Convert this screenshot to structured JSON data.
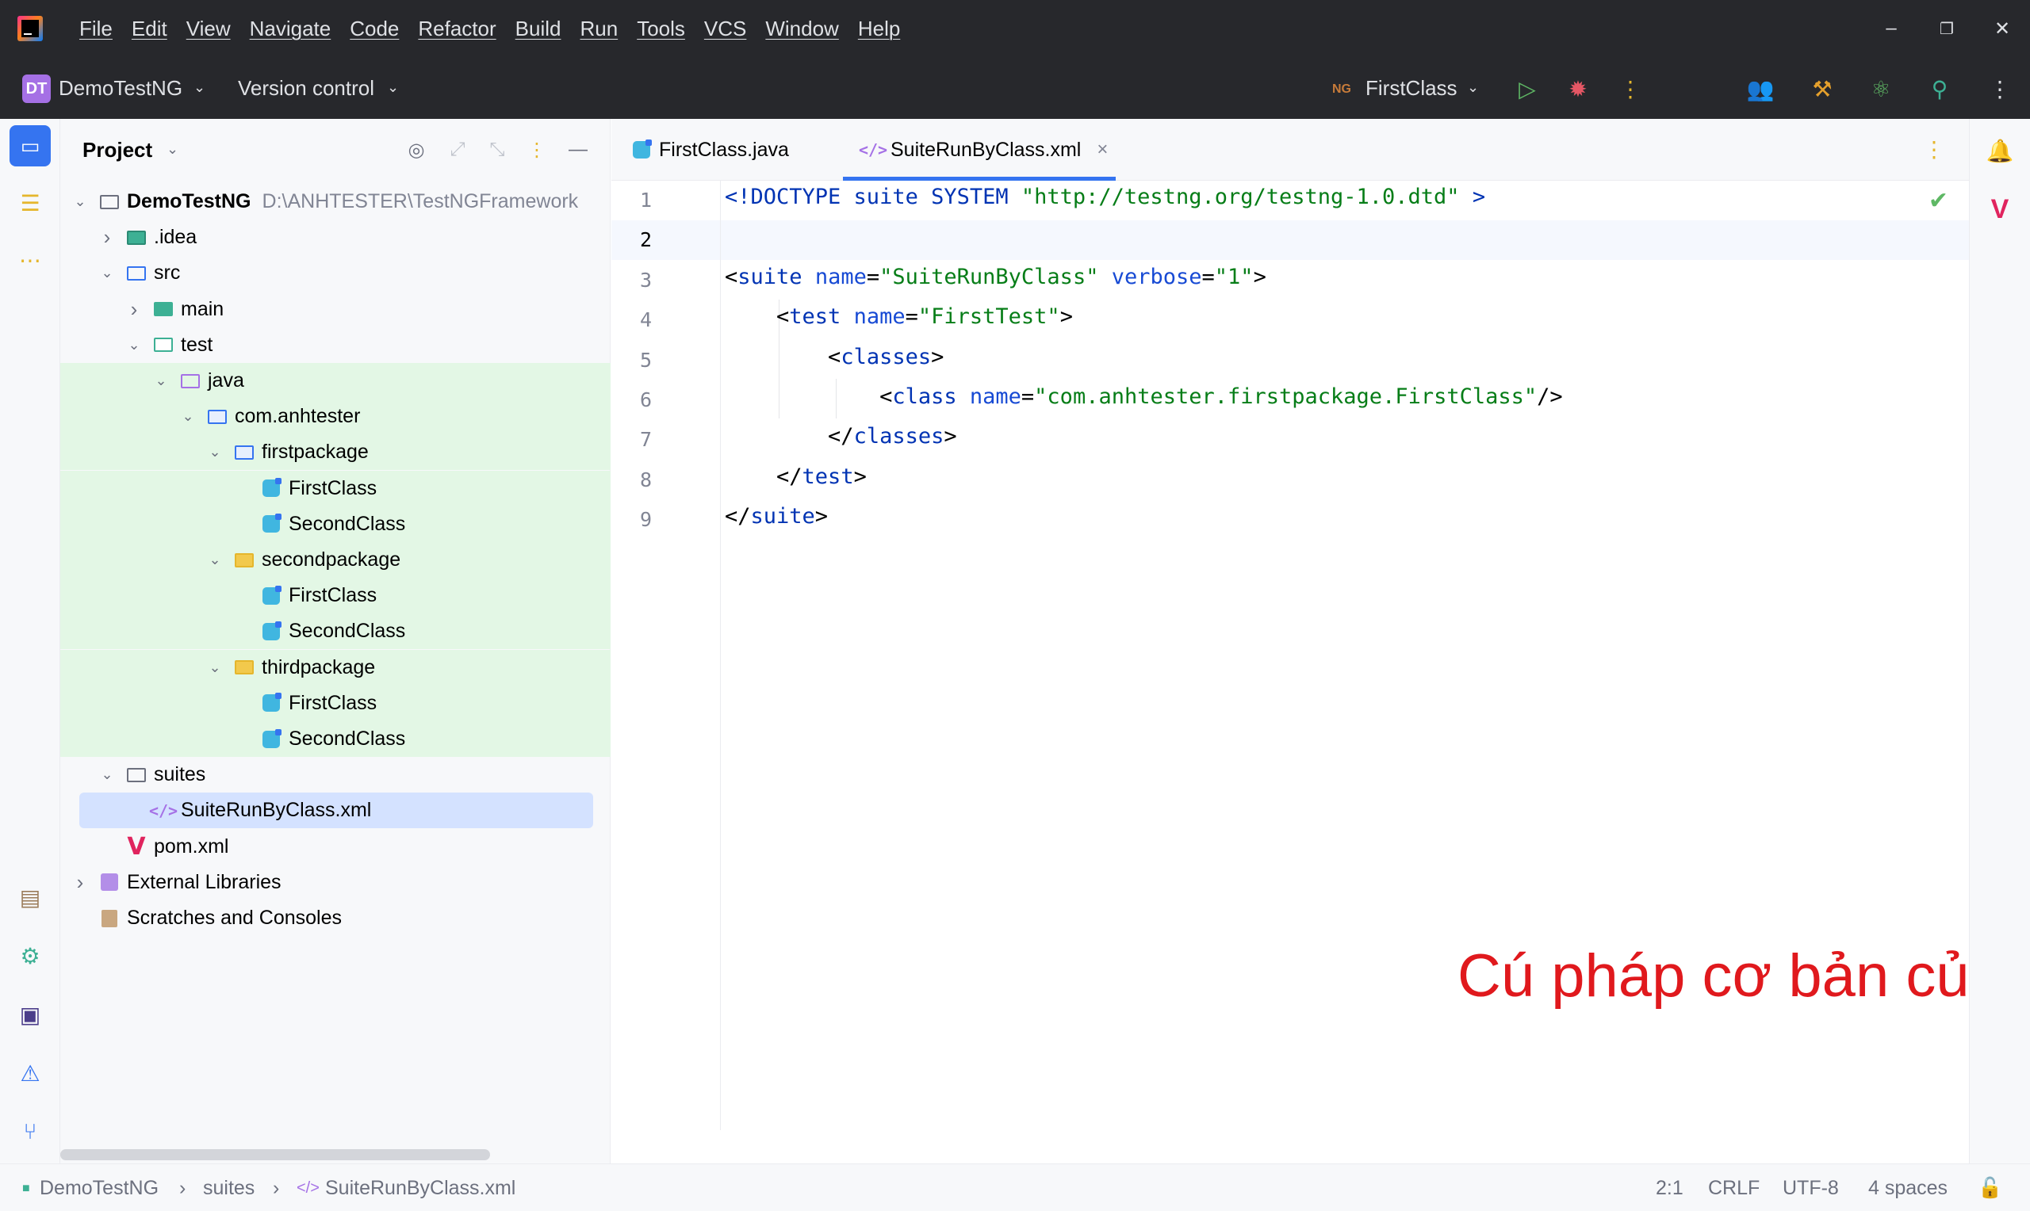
{
  "menu": [
    "File",
    "Edit",
    "View",
    "Navigate",
    "Code",
    "Refactor",
    "Build",
    "Run",
    "Tools",
    "VCS",
    "Window",
    "Help"
  ],
  "window_controls": {
    "minimize": "–",
    "restore": "❐",
    "close": "✕"
  },
  "toolbar": {
    "project_badge": "DT",
    "project_name": "DemoTestNG",
    "vcs": "Version control",
    "run_config_icon": "NG",
    "run_config": "FirstClass"
  },
  "project_panel": {
    "title": "Project",
    "tree": [
      {
        "label": "DemoTestNG",
        "sub": "D:\\ANHTESTER\\TestNGFramework",
        "level": 0,
        "chev": "open",
        "icon": "folder",
        "bold": true
      },
      {
        "label": ".idea",
        "level": 1,
        "chev": "closed",
        "icon": "idea"
      },
      {
        "label": "src",
        "level": 1,
        "chev": "open",
        "icon": "src"
      },
      {
        "label": "main",
        "level": 2,
        "chev": "closed",
        "icon": "teal"
      },
      {
        "label": "test",
        "level": 2,
        "chev": "open",
        "icon": "testf"
      },
      {
        "label": "java",
        "level": 3,
        "chev": "open",
        "icon": "purple",
        "hl": true
      },
      {
        "label": "com.anhtester",
        "level": 4,
        "chev": "open",
        "icon": "blue",
        "hl": true
      },
      {
        "label": "firstpackage",
        "level": 5,
        "chev": "open",
        "icon": "blue",
        "hl": true
      },
      {
        "label": "FirstClass",
        "level": 6,
        "chev": "none",
        "icon": "class",
        "hl": true
      },
      {
        "label": "SecondClass",
        "level": 6,
        "chev": "none",
        "icon": "class",
        "hl": true
      },
      {
        "label": "secondpackage",
        "level": 5,
        "chev": "open",
        "icon": "yellow",
        "hl": true
      },
      {
        "label": "FirstClass",
        "level": 6,
        "chev": "none",
        "icon": "class",
        "hl": true
      },
      {
        "label": "SecondClass",
        "level": 6,
        "chev": "none",
        "icon": "class",
        "hl": true
      },
      {
        "label": "thirdpackage",
        "level": 5,
        "chev": "open",
        "icon": "yellow",
        "hl": true
      },
      {
        "label": "FirstClass",
        "level": 6,
        "chev": "none",
        "icon": "class",
        "hl": true
      },
      {
        "label": "SecondClass",
        "level": 6,
        "chev": "none",
        "icon": "class",
        "hl": true
      },
      {
        "label": "suites",
        "level": 1,
        "chev": "open",
        "icon": "folder"
      },
      {
        "label": "SuiteRunByClass.xml",
        "level": 2,
        "chev": "none",
        "icon": "xml",
        "sel": true
      },
      {
        "label": "pom.xml",
        "level": 1,
        "chev": "none",
        "icon": "maven"
      },
      {
        "label": "External Libraries",
        "level": 0,
        "chev": "closed",
        "icon": "lib"
      },
      {
        "label": "Scratches and Consoles",
        "level": 0,
        "chev": "none",
        "icon": "scratch"
      }
    ]
  },
  "tabs": [
    {
      "label": "FirstClass.java",
      "icon": "class",
      "active": false
    },
    {
      "label": "SuiteRunByClass.xml",
      "icon": "xml",
      "active": true,
      "close": "×"
    }
  ],
  "editor": {
    "line_numbers": [
      "1",
      "2",
      "3",
      "4",
      "5",
      "6",
      "7",
      "8",
      "9"
    ],
    "lines": [
      [
        {
          "t": "<!DOCTYPE suite SYSTEM ",
          "c": "kw"
        },
        {
          "t": "\"http://testng.org/testng-1.0.dtd\"",
          "c": "st"
        },
        {
          "t": " >",
          "c": "kw"
        }
      ],
      [],
      [
        {
          "t": "<",
          "c": ""
        },
        {
          "t": "suite",
          "c": "kw"
        },
        {
          "t": " ",
          "c": ""
        },
        {
          "t": "name",
          "c": "at"
        },
        {
          "t": "=",
          "c": ""
        },
        {
          "t": "\"SuiteRunByClass\"",
          "c": "st"
        },
        {
          "t": " ",
          "c": ""
        },
        {
          "t": "verbose",
          "c": "at"
        },
        {
          "t": "=",
          "c": ""
        },
        {
          "t": "\"1\"",
          "c": "st"
        },
        {
          "t": ">",
          "c": ""
        }
      ],
      [
        {
          "t": "    <",
          "c": ""
        },
        {
          "t": "test",
          "c": "kw"
        },
        {
          "t": " ",
          "c": ""
        },
        {
          "t": "name",
          "c": "at"
        },
        {
          "t": "=",
          "c": ""
        },
        {
          "t": "\"FirstTest\"",
          "c": "st"
        },
        {
          "t": ">",
          "c": ""
        }
      ],
      [
        {
          "t": "        <",
          "c": ""
        },
        {
          "t": "classes",
          "c": "kw"
        },
        {
          "t": ">",
          "c": ""
        }
      ],
      [
        {
          "t": "            <",
          "c": ""
        },
        {
          "t": "class",
          "c": "kw"
        },
        {
          "t": " ",
          "c": ""
        },
        {
          "t": "name",
          "c": "at"
        },
        {
          "t": "=",
          "c": ""
        },
        {
          "t": "\"com.anhtester.firstpackage.FirstClass\"",
          "c": "st"
        },
        {
          "t": "/>",
          "c": ""
        }
      ],
      [
        {
          "t": "        </",
          "c": ""
        },
        {
          "t": "classes",
          "c": "kw"
        },
        {
          "t": ">",
          "c": ""
        }
      ],
      [
        {
          "t": "    </",
          "c": ""
        },
        {
          "t": "test",
          "c": "kw"
        },
        {
          "t": ">",
          "c": ""
        }
      ],
      [
        {
          "t": "</",
          "c": ""
        },
        {
          "t": "suite",
          "c": "kw"
        },
        {
          "t": ">",
          "c": ""
        }
      ]
    ],
    "caption": "Cú pháp cơ bản của một file XML"
  },
  "statusbar": {
    "breadcrumbs": [
      "DemoTestNG",
      "suites",
      "SuiteRunByClass.xml"
    ],
    "position": "2:1",
    "line_ending": "CRLF",
    "encoding": "UTF-8",
    "indent": "4 spaces"
  },
  "colors": {
    "accent": "#3574f0",
    "caption": "#e0191d",
    "highlight": "#e3f7e5",
    "selection": "#d4e2ff"
  }
}
